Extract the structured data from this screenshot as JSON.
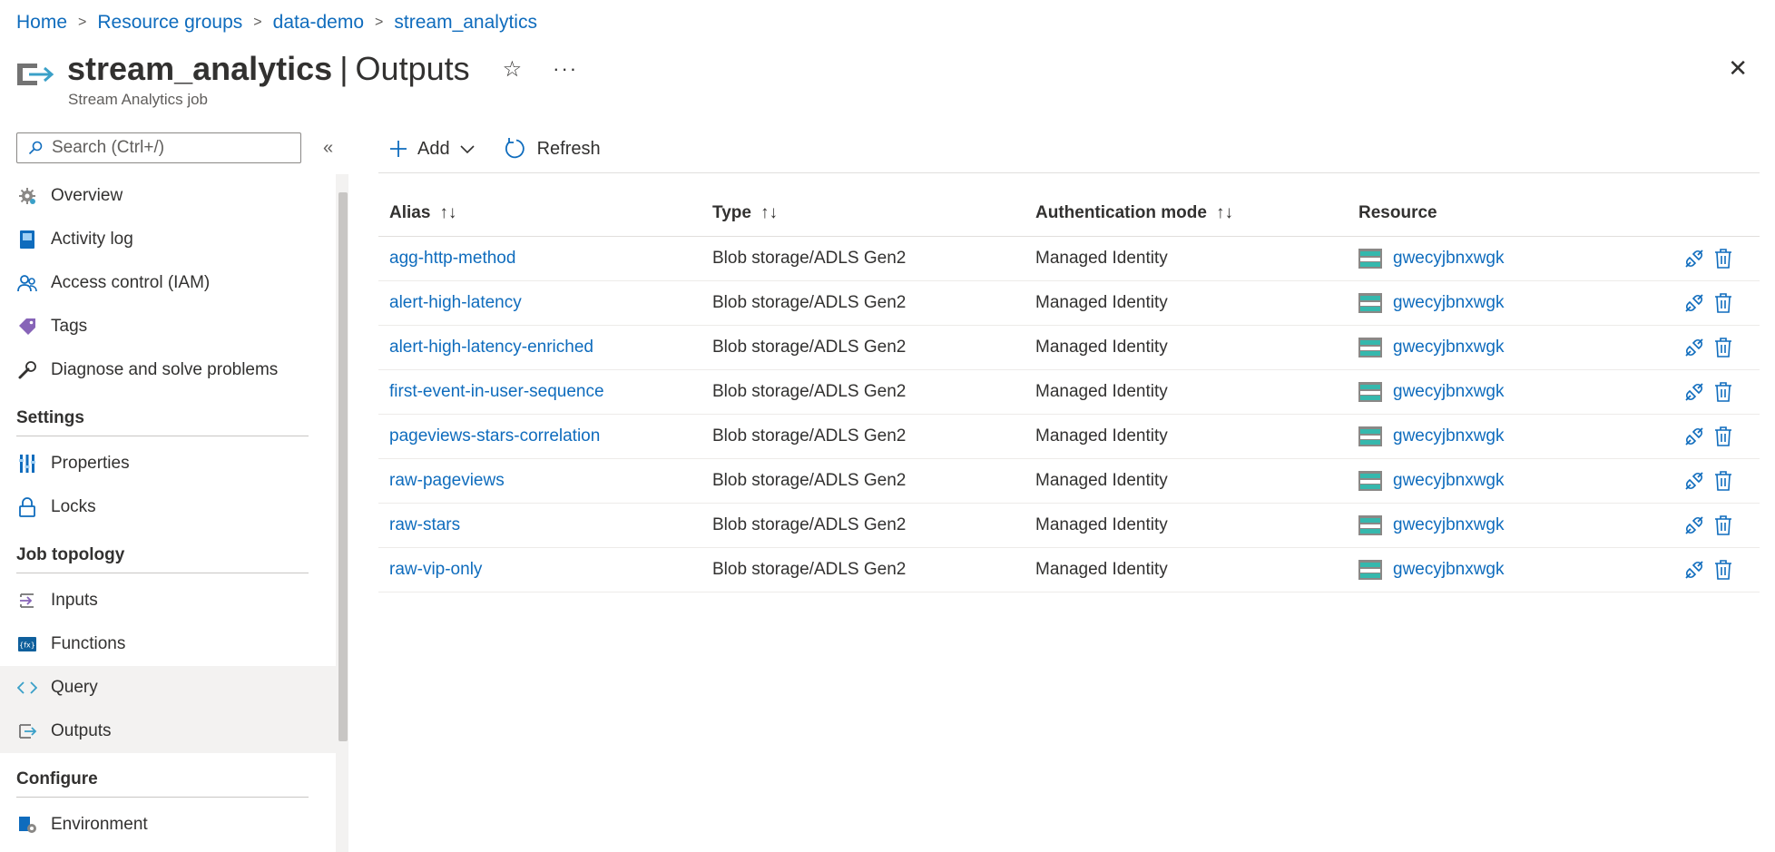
{
  "breadcrumb": {
    "items": [
      "Home",
      "Resource groups",
      "data-demo",
      "stream_analytics"
    ]
  },
  "header": {
    "title": "stream_analytics",
    "section": "Outputs",
    "title_separator": "|",
    "resource_type": "Stream Analytics job",
    "star_icon": "☆",
    "more_icon": "···",
    "close_icon": "✕"
  },
  "sidebar": {
    "search_placeholder": "Search (Ctrl+/)",
    "collapse_icon": "«",
    "top_items": [
      {
        "label": "Overview",
        "icon": "gear-icon"
      },
      {
        "label": "Activity log",
        "icon": "log-icon"
      },
      {
        "label": "Access control (IAM)",
        "icon": "people-icon"
      },
      {
        "label": "Tags",
        "icon": "tag-icon"
      },
      {
        "label": "Diagnose and solve problems",
        "icon": "wrench-icon"
      }
    ],
    "sections": [
      {
        "title": "Settings",
        "items": [
          {
            "label": "Properties",
            "icon": "properties-icon"
          },
          {
            "label": "Locks",
            "icon": "lock-icon"
          }
        ]
      },
      {
        "title": "Job topology",
        "items": [
          {
            "label": "Inputs",
            "icon": "inputs-icon"
          },
          {
            "label": "Functions",
            "icon": "functions-icon"
          },
          {
            "label": "Query",
            "icon": "code-icon"
          },
          {
            "label": "Outputs",
            "icon": "outputs-icon"
          }
        ]
      },
      {
        "title": "Configure",
        "items": [
          {
            "label": "Environment",
            "icon": "environment-icon"
          }
        ]
      }
    ]
  },
  "toolbar": {
    "add_label": "Add",
    "refresh_label": "Refresh"
  },
  "table": {
    "columns": [
      "Alias",
      "Type",
      "Authentication mode",
      "Resource"
    ],
    "sort_icon": "↑↓",
    "rows": [
      {
        "alias": "agg-http-method",
        "type": "Blob storage/ADLS Gen2",
        "auth": "Managed Identity",
        "resource": "gwecyjbnxwgk"
      },
      {
        "alias": "alert-high-latency",
        "type": "Blob storage/ADLS Gen2",
        "auth": "Managed Identity",
        "resource": "gwecyjbnxwgk"
      },
      {
        "alias": "alert-high-latency-enriched",
        "type": "Blob storage/ADLS Gen2",
        "auth": "Managed Identity",
        "resource": "gwecyjbnxwgk"
      },
      {
        "alias": "first-event-in-user-sequence",
        "type": "Blob storage/ADLS Gen2",
        "auth": "Managed Identity",
        "resource": "gwecyjbnxwgk"
      },
      {
        "alias": "pageviews-stars-correlation",
        "type": "Blob storage/ADLS Gen2",
        "auth": "Managed Identity",
        "resource": "gwecyjbnxwgk"
      },
      {
        "alias": "raw-pageviews",
        "type": "Blob storage/ADLS Gen2",
        "auth": "Managed Identity",
        "resource": "gwecyjbnxwgk"
      },
      {
        "alias": "raw-stars",
        "type": "Blob storage/ADLS Gen2",
        "auth": "Managed Identity",
        "resource": "gwecyjbnxwgk"
      },
      {
        "alias": "raw-vip-only",
        "type": "Blob storage/ADLS Gen2",
        "auth": "Managed Identity",
        "resource": "gwecyjbnxwgk"
      }
    ]
  },
  "colors": {
    "link": "#0f6cbd",
    "text": "#323130",
    "muted": "#605e5c",
    "highlight": "#f3f2f1",
    "storage_teal": "#35b8ad"
  }
}
